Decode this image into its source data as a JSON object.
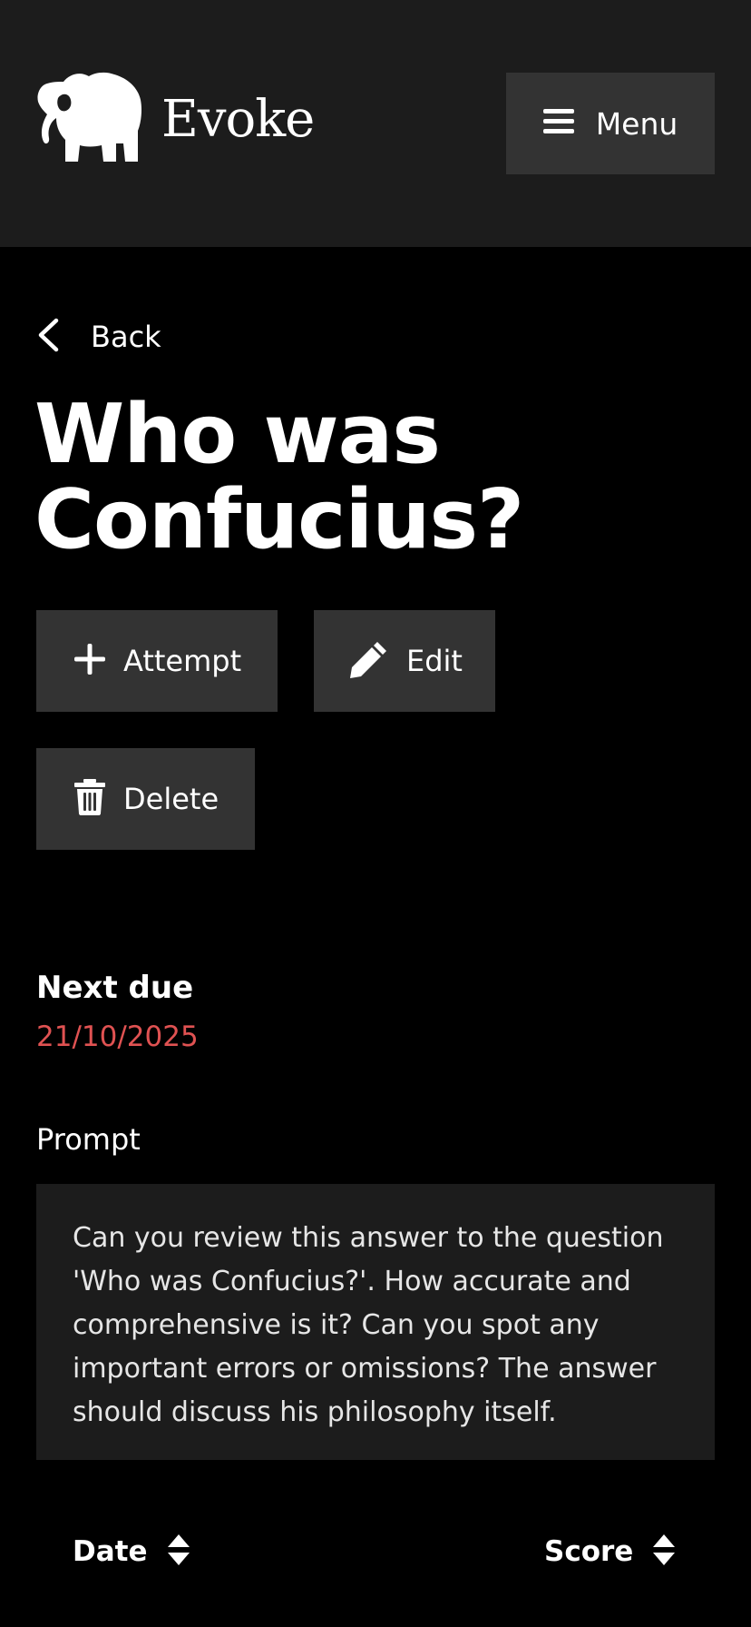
{
  "header": {
    "brand": "Evoke",
    "logo_icon": "elephant-icon",
    "menu_label": "Menu",
    "menu_icon": "hamburger-icon"
  },
  "nav": {
    "back_label": "Back",
    "back_icon": "chevron-left-icon"
  },
  "page": {
    "title_line1": "Who was",
    "title_line2": "Confucius?"
  },
  "actions": {
    "attempt_label": "Attempt",
    "attempt_icon": "plus-icon",
    "edit_label": "Edit",
    "edit_icon": "pencil-icon",
    "delete_label": "Delete",
    "delete_icon": "trash-icon"
  },
  "details": {
    "next_due_label": "Next due",
    "next_due_value": "21/10/2025",
    "prompt_label": "Prompt",
    "prompt_text": "Can you review this answer to the question 'Who was Confucius?'. How accurate and comprehensive is it? Can you spot any important errors or omissions? The answer should discuss his philosophy itself."
  },
  "table": {
    "columns": [
      "Date",
      "Score"
    ],
    "sort_icon": "sort-icon"
  },
  "colors": {
    "background": "#000000",
    "header_bg": "#1c1c1c",
    "button_bg": "#333333",
    "due_date": "#e05252",
    "prompt_bg": "#1c1c1c"
  }
}
